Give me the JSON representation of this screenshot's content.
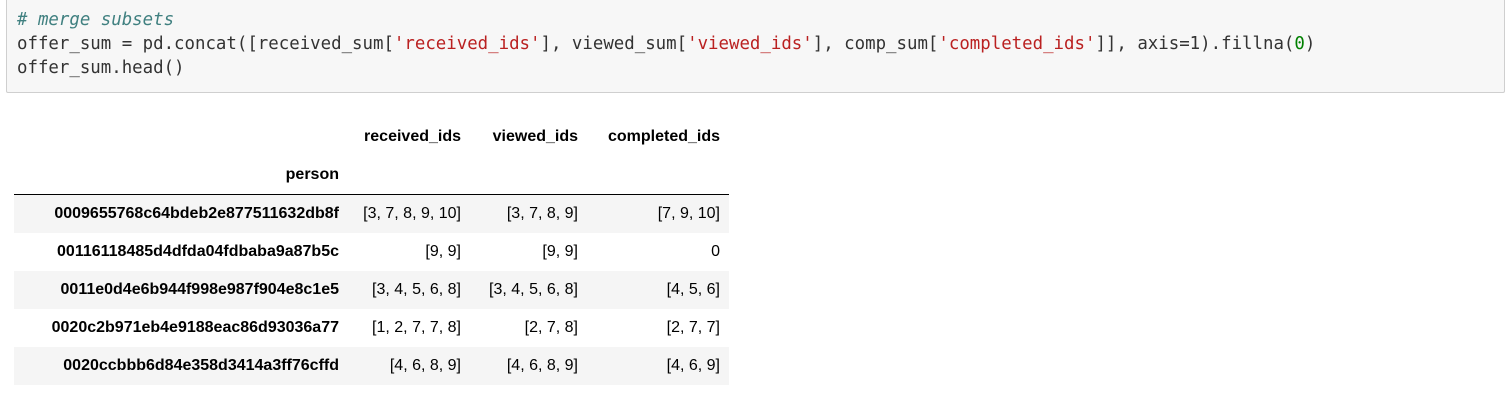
{
  "code": {
    "comment": "# merge subsets",
    "line2": {
      "p1": "offer_sum = pd.concat([received_sum[",
      "s1": "'received_ids'",
      "p2": "], viewed_sum[",
      "s2": "'viewed_ids'",
      "p3": "], comp_sum[",
      "s3": "'completed_ids'",
      "p4": "]], axis=1).fillna(",
      "n1": "0",
      "p5": ")"
    },
    "line3": "offer_sum.head()"
  },
  "output": {
    "columns": [
      "received_ids",
      "viewed_ids",
      "completed_ids"
    ],
    "index_name": "person",
    "rows": [
      {
        "person": "0009655768c64bdeb2e877511632db8f",
        "received_ids": "[3, 7, 8, 9, 10]",
        "viewed_ids": "[3, 7, 8, 9]",
        "completed_ids": "[7, 9, 10]"
      },
      {
        "person": "00116118485d4dfda04fdbaba9a87b5c",
        "received_ids": "[9, 9]",
        "viewed_ids": "[9, 9]",
        "completed_ids": "0"
      },
      {
        "person": "0011e0d4e6b944f998e987f904e8c1e5",
        "received_ids": "[3, 4, 5, 6, 8]",
        "viewed_ids": "[3, 4, 5, 6, 8]",
        "completed_ids": "[4, 5, 6]"
      },
      {
        "person": "0020c2b971eb4e9188eac86d93036a77",
        "received_ids": "[1, 2, 7, 7, 8]",
        "viewed_ids": "[2, 7, 8]",
        "completed_ids": "[2, 7, 7]"
      },
      {
        "person": "0020ccbbb6d84e358d3414a3ff76cffd",
        "received_ids": "[4, 6, 8, 9]",
        "viewed_ids": "[4, 6, 8, 9]",
        "completed_ids": "[4, 6, 9]"
      }
    ]
  }
}
